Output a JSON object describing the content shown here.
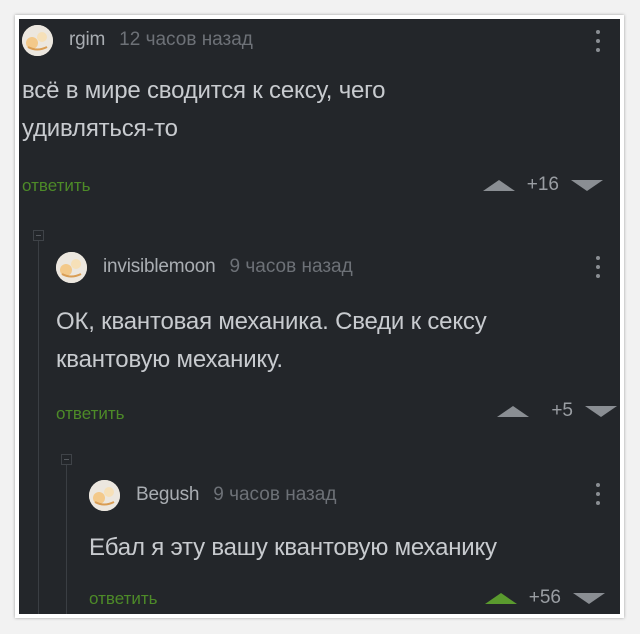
{
  "comments": [
    {
      "author": "rgim",
      "time": "12 часов назад",
      "text": "всё в мире сводится к сексу, чего удивляться-то",
      "reply": "ответить",
      "score": "+16",
      "upvoted": false
    },
    {
      "author": "invisiblemoon",
      "time": "9 часов назад",
      "text": "ОК, квантовая механика. Сведи к сексу квантовую механику.",
      "reply": "ответить",
      "score": "+5",
      "upvoted": false
    },
    {
      "author": "Begush",
      "time": "9 часов назад",
      "text": "Ебал я эту вашу квантовую механику",
      "reply": "ответить",
      "score": "+56",
      "upvoted": true
    }
  ],
  "colors": {
    "background": "#23262a",
    "reply_link": "#4d8a28",
    "upvote_active": "#5a9a2e",
    "text": "#c8cbcf"
  },
  "icons": {
    "menu": "vertical-ellipsis-icon",
    "upvote": "triangle-up-icon",
    "downvote": "triangle-down-icon",
    "avatar": "default-avatar-icon",
    "collapse": "collapse-thread-icon"
  }
}
